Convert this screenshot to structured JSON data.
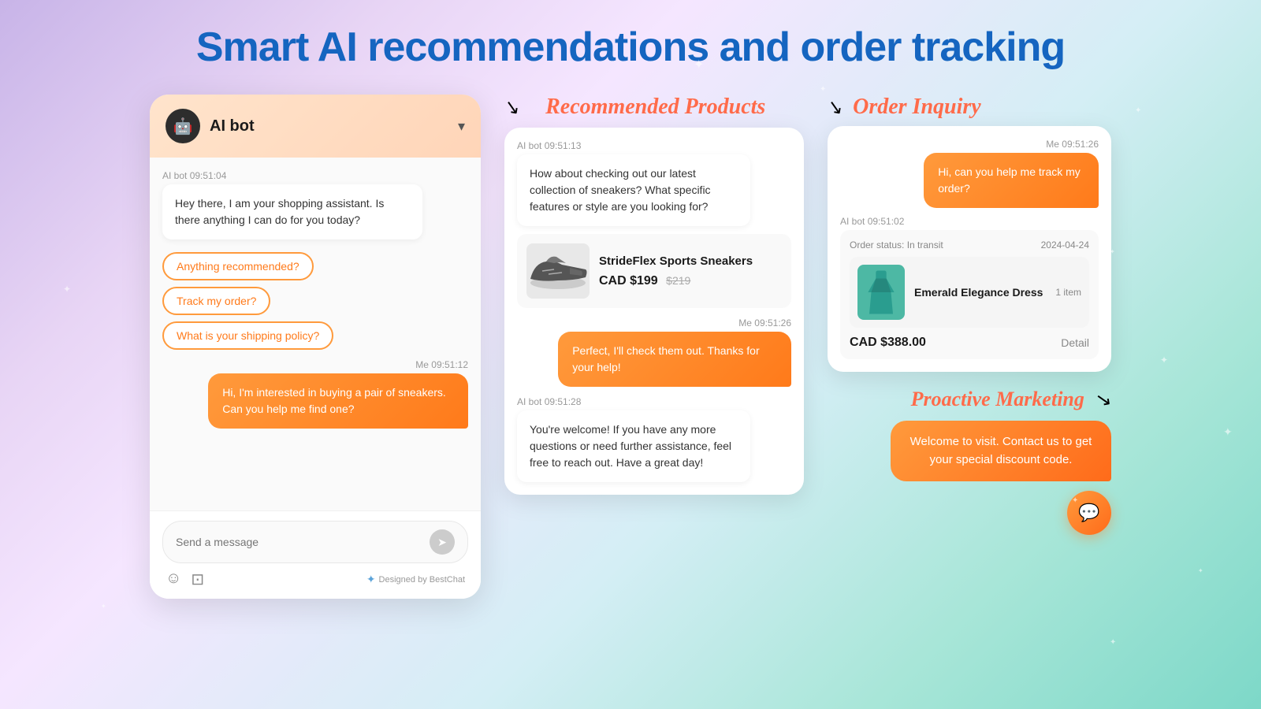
{
  "page": {
    "title": "Smart AI recommendations and order tracking",
    "background": "linear-gradient(135deg, #c8b4e8, #a8e6d8)"
  },
  "chat_widget": {
    "bot_name": "AI bot",
    "chevron_label": "▾",
    "bot_avatar_emoji": "🤖",
    "messages": [
      {
        "sender": "bot",
        "time": "AI bot 09:51:04",
        "text": "Hey there, I am your shopping assistant. Is there anything I can do for you today?"
      }
    ],
    "quick_replies": [
      "Anything recommended?",
      "Track my order?",
      "What is your shipping policy?"
    ],
    "user_message": {
      "time": "Me 09:51:12",
      "text": "Hi, I'm interested in buying a pair of sneakers. Can you help me find one?"
    },
    "input_placeholder": "Send a message",
    "send_icon": "➤",
    "emoji_icon": "☺",
    "image_icon": "⊡",
    "brand_text": "Designed by BestChat"
  },
  "recommended_panel": {
    "label": "Recommended Products",
    "bot_time": "AI bot 09:51:13",
    "bot_message": "How about checking out our latest collection of sneakers? What specific features or style are you looking for?",
    "product": {
      "name": "StrideFlex Sports Sneakers",
      "price": "CAD $199",
      "old_price": "$219"
    },
    "user_time": "Me 09:51:26",
    "user_message": "Perfect, I'll check them out. Thanks for your help!",
    "bot_time2": "AI bot 09:51:28",
    "bot_message2": "You're welcome! If you have any more questions or need further assistance, feel free to reach out. Have a great day!"
  },
  "order_panel": {
    "label": "Order Inquiry",
    "user_time": "Me 09:51:26",
    "user_message": "Hi, can you help me track my order?",
    "bot_time": "AI bot 09:51:02",
    "order_status": "Order status: In transit",
    "order_date": "2024-04-24",
    "item": {
      "name": "Emerald Elegance Dress",
      "count": "1 item",
      "price": "CAD $388.00"
    },
    "detail_link": "Detail"
  },
  "proactive_panel": {
    "label": "Proactive Marketing",
    "message": "Welcome to visit. Contact us to get your special discount code.",
    "chat_icon": "💬"
  }
}
